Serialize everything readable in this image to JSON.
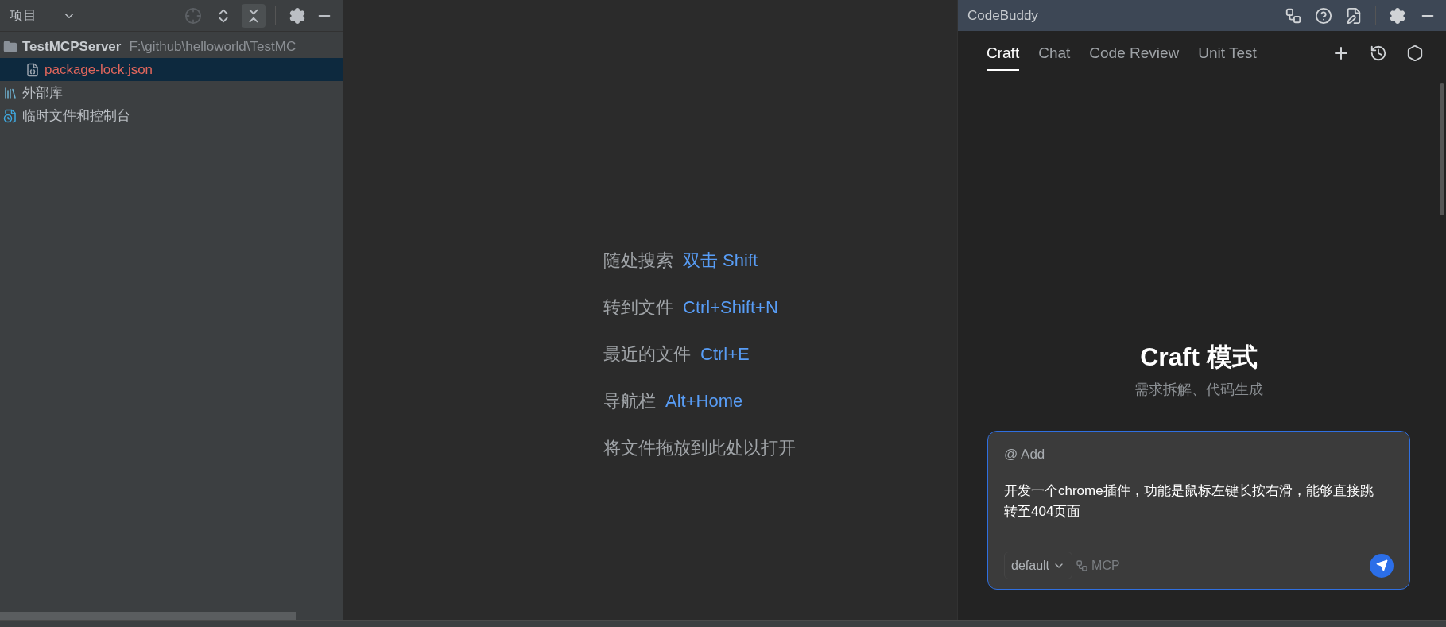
{
  "project_panel": {
    "title": "项目",
    "tree": [
      {
        "name": "TestMCPServer",
        "path": "F:\\github\\helloworld\\TestMC",
        "kind": "folder",
        "selected": false,
        "children": [
          {
            "name": "package-lock.json",
            "kind": "json",
            "selected": true
          }
        ]
      },
      {
        "name": "外部库",
        "kind": "library",
        "selected": false
      },
      {
        "name": "临时文件和控制台",
        "kind": "scratch",
        "selected": false
      }
    ]
  },
  "editor_hints": [
    {
      "label": "随处搜索",
      "shortcut": "双击 Shift"
    },
    {
      "label": "转到文件",
      "shortcut": "Ctrl+Shift+N"
    },
    {
      "label": "最近的文件",
      "shortcut": "Ctrl+E"
    },
    {
      "label": "导航栏",
      "shortcut": "Alt+Home"
    },
    {
      "label": "将文件拖放到此处以打开"
    }
  ],
  "codebuddy": {
    "title": "CodeBuddy",
    "tabs": [
      {
        "label": "Craft",
        "selected": true
      },
      {
        "label": "Chat",
        "selected": false
      },
      {
        "label": "Code Review",
        "selected": false
      },
      {
        "label": "Unit Test",
        "selected": false
      }
    ],
    "heading": "Craft 模式",
    "subtitle": "需求拆解、代码生成",
    "input": {
      "mention": "@ Add",
      "value": "开发一个chrome插件，功能是鼠标左键长按右滑，能够直接跳转至404页面",
      "model": "default",
      "mcp": "MCP"
    }
  }
}
